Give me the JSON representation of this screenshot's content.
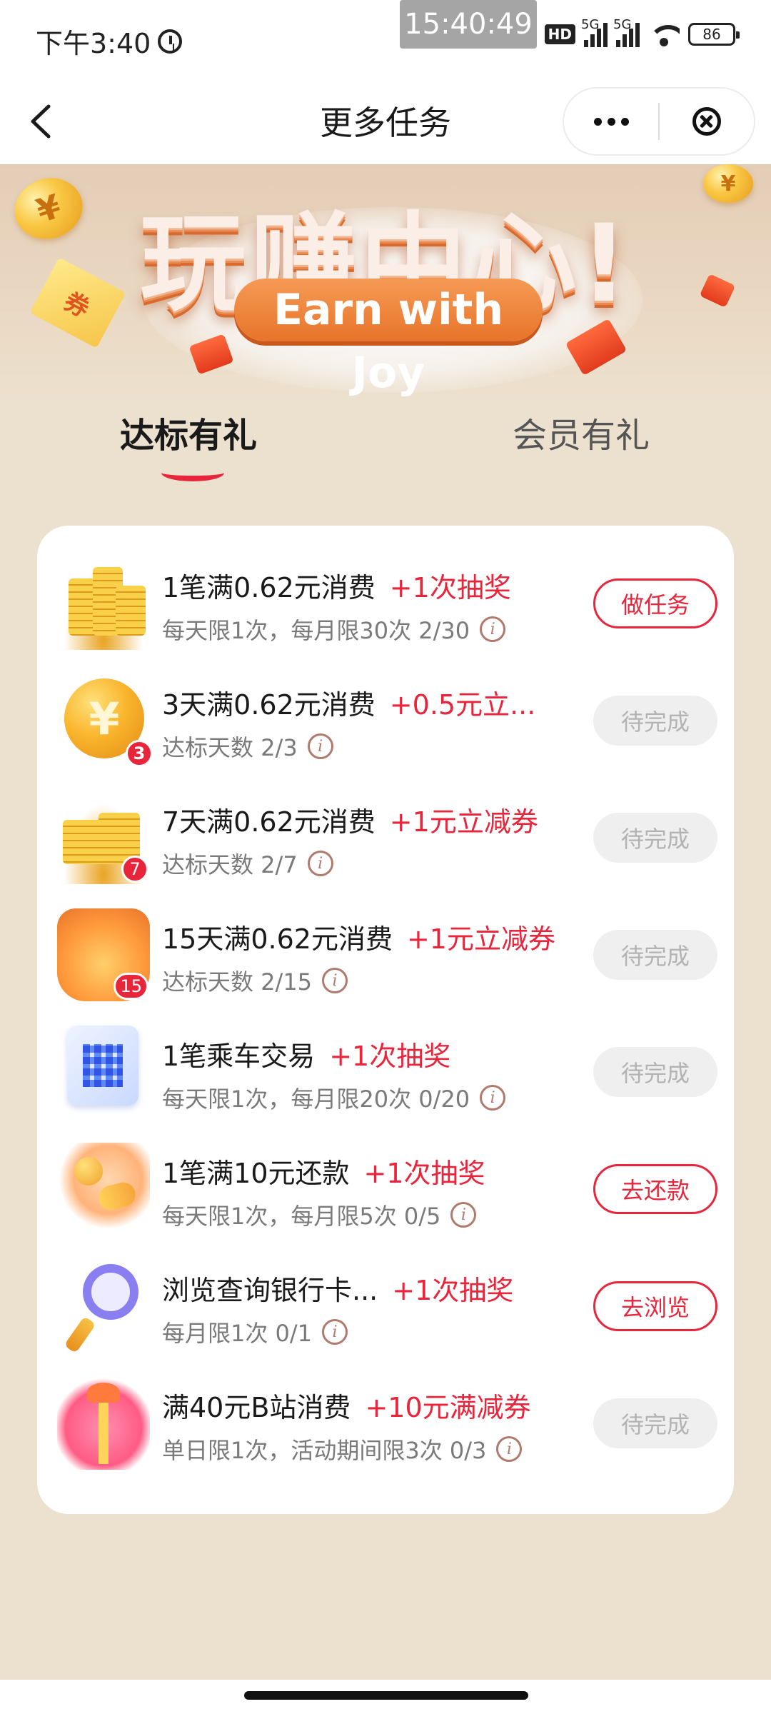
{
  "status_bar": {
    "time": "下午3:40",
    "clock_overlay": "15:40:49",
    "hd_label": "HD",
    "signal_labels": [
      "5G",
      "5G"
    ],
    "battery": "86",
    "icons": [
      "alarm-icon",
      "signal-icon",
      "wifi-icon",
      "battery-icon"
    ]
  },
  "nav": {
    "title": "更多任务",
    "icons": [
      "back-chevron-icon",
      "more-dots-icon",
      "close-circle-icon"
    ]
  },
  "banner": {
    "title": "玩赚中心!",
    "subtitle": "Earn with Joy",
    "coin_glyph": "¥",
    "ticket_glyph": "券"
  },
  "tabs": [
    {
      "label": "达标有礼",
      "active": true
    },
    {
      "label": "会员有礼",
      "active": false
    }
  ],
  "tasks": [
    {
      "icon": "gold-coins-icon",
      "badge": "",
      "title": "1笔满0.62元消费",
      "reward": "+1次抽奖",
      "sub": "每天限1次，每月限30次  2/30",
      "button": "做任务",
      "button_state": "active"
    },
    {
      "icon": "yuan-coin-icon",
      "badge": "3",
      "title": "3天满0.62元消费",
      "reward": "+0.5元立...",
      "sub": "达标天数  2/3",
      "button": "待完成",
      "button_state": "pending"
    },
    {
      "icon": "coin-stack-icon",
      "badge": "7",
      "title": "7天满0.62元消费",
      "reward": "+1元立减券",
      "sub": "达标天数  2/7",
      "button": "待完成",
      "button_state": "pending"
    },
    {
      "icon": "treasure-box-icon",
      "badge": "15",
      "title": "15天满0.62元消费",
      "reward": "+1元立减券",
      "sub": "达标天数  2/15",
      "button": "待完成",
      "button_state": "pending"
    },
    {
      "icon": "qr-code-icon",
      "badge": "",
      "title": "1笔乘车交易",
      "reward": "+1次抽奖",
      "sub": "每天限1次，每月限20次  0/20",
      "button": "待完成",
      "button_state": "pending"
    },
    {
      "icon": "hand-coin-icon",
      "badge": "",
      "title": "1笔满10元还款",
      "reward": "+1次抽奖",
      "sub": "每天限1次，每月限5次  0/5",
      "button": "去还款",
      "button_state": "active"
    },
    {
      "icon": "magnifier-icon",
      "badge": "",
      "title": "浏览查询银行卡...",
      "reward": "+1次抽奖",
      "sub": "每月限1次  0/1",
      "button": "去浏览",
      "button_state": "active"
    },
    {
      "icon": "gift-box-icon",
      "badge": "",
      "title": "满40元B站消费",
      "reward": "+10元满减券",
      "sub": "单日限1次，活动期间限3次  0/3",
      "button": "待完成",
      "button_state": "pending"
    }
  ],
  "info_glyph": "i",
  "colors": {
    "accent": "#e8253b",
    "page_bg": "#ece1ce",
    "pending_bg": "#efefef",
    "pending_text": "#b3b3b3",
    "banner_orange": "#e8742a"
  }
}
